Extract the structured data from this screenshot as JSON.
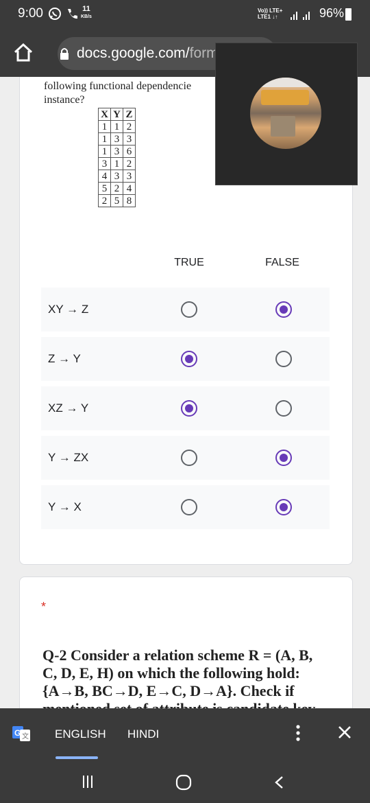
{
  "status_bar": {
    "time": "9:00",
    "speed_value": "11",
    "speed_unit": "KB/s",
    "network_top": "Vo)) LTE+",
    "network_bottom": "LTE1 ↓↑",
    "battery": "96%"
  },
  "browser": {
    "url_host": "docs.google.com/",
    "url_path": "forms"
  },
  "question1": {
    "text_line1": "following  functional  dependencie",
    "text_line2": "instance?",
    "relation_headers": [
      "X",
      "Y",
      "Z"
    ],
    "relation_rows": [
      [
        "1",
        "1",
        "2"
      ],
      [
        "1",
        "3",
        "3"
      ],
      [
        "1",
        "3",
        "6"
      ],
      [
        "3",
        "1",
        "2"
      ],
      [
        "4",
        "3",
        "3"
      ],
      [
        "5",
        "2",
        "4"
      ],
      [
        "2",
        "5",
        "8"
      ]
    ],
    "col_true": "TRUE",
    "col_false": "FALSE",
    "rows": [
      {
        "label": "XY → Z",
        "selected": "false"
      },
      {
        "label": "Z → Y",
        "selected": "true"
      },
      {
        "label": "XZ → Y",
        "selected": "true"
      },
      {
        "label": "Y → ZX",
        "selected": "false"
      },
      {
        "label": "Y → X",
        "selected": "false"
      }
    ]
  },
  "question2": {
    "required_mark": "*",
    "text": "Q-2 Consider a relation scheme R = (A, B, C, D, E, H) on which the following hold: {A→B, BC→D, E→C, D→A}. Check if mentioned set of attribute is candidate key"
  },
  "translate_bar": {
    "lang_active": "ENGLISH",
    "lang_other": "HINDI"
  },
  "colors": {
    "accent": "#673ab7",
    "dark_bar": "#3a3a3a",
    "required": "#d93025",
    "translate_underline": "#8ab4f8"
  }
}
